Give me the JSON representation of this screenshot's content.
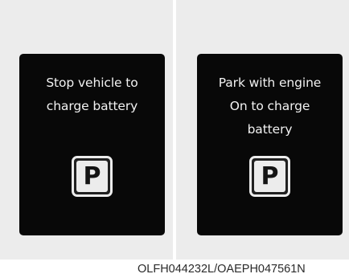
{
  "panels": [
    {
      "message_lines": [
        "Stop vehicle to",
        "charge battery"
      ],
      "gear_letter": "P"
    },
    {
      "message_lines": [
        "Park with engine",
        "On to charge",
        "battery"
      ],
      "gear_letter": "P"
    }
  ],
  "caption": "OLFH044232L/OAEPH047561N",
  "colors": {
    "screen_background": "#080808",
    "text": "#f2f2f2",
    "panel_background": "#ececec"
  }
}
